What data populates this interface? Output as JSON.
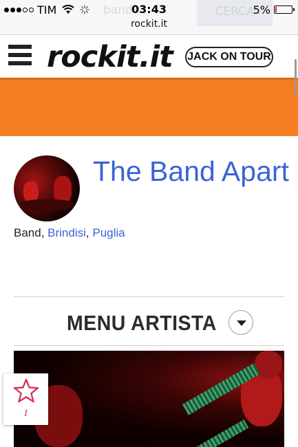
{
  "status_bar": {
    "carrier": "TIM",
    "time": "03:43",
    "battery": "5%",
    "battery_level": 0.05,
    "url": "rockit.it"
  },
  "underlay": {
    "search_text": "band",
    "search_button": "CERCA"
  },
  "header": {
    "logo": "rockit.it",
    "badge": "JACK ON TOUR"
  },
  "artist": {
    "name": "The Band Apart",
    "type": "Band",
    "city": "Brindisi",
    "region": "Puglia"
  },
  "artist_menu": {
    "title": "MENU ARTISTA"
  },
  "favorite": {
    "count": "1"
  },
  "colors": {
    "accent_orange": "#f47e20",
    "link_blue": "#3b63d6",
    "fav_pink": "#d2385a"
  }
}
